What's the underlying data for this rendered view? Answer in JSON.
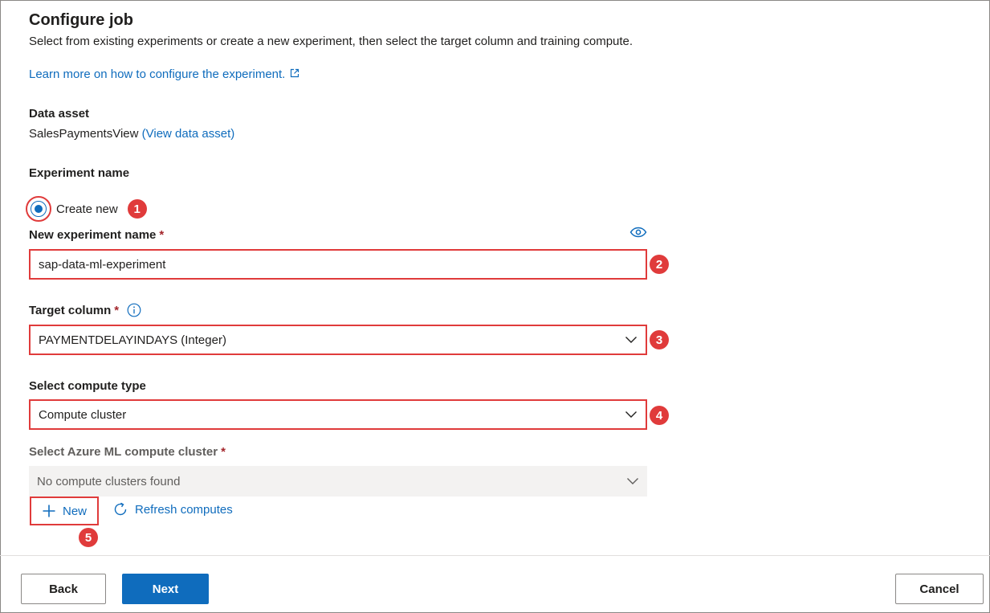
{
  "header": {
    "title": "Configure job",
    "description": "Select from existing experiments or create a new experiment, then select the target column and training compute.",
    "learn_more": "Learn more on how to configure the experiment."
  },
  "data_asset": {
    "label": "Data asset",
    "name": "SalesPaymentsView",
    "view_link": "(View data asset)"
  },
  "experiment": {
    "label": "Experiment name",
    "create_new_label": "Create new",
    "create_new_selected": true,
    "name_label": "New experiment name",
    "name_value": "sap-data-ml-experiment"
  },
  "target_column": {
    "label": "Target column",
    "value": "PAYMENTDELAYINDAYS (Integer)"
  },
  "compute_type": {
    "label": "Select compute type",
    "value": "Compute cluster"
  },
  "compute_cluster": {
    "label": "Select Azure ML compute cluster",
    "value": "No compute clusters found"
  },
  "actions": {
    "new_label": "New",
    "refresh_label": "Refresh computes"
  },
  "required_mark": "*",
  "callouts": [
    "1",
    "2",
    "3",
    "4",
    "5"
  ],
  "footer": {
    "back_label": "Back",
    "next_label": "Next",
    "cancel_label": "Cancel"
  },
  "colors": {
    "accent": "#0f6cbd",
    "callout": "#e03b3b",
    "required": "#a4262c"
  },
  "icons": [
    "external-link-icon",
    "eye-icon",
    "info-icon",
    "chevron-down-icon",
    "plus-icon",
    "refresh-icon"
  ]
}
